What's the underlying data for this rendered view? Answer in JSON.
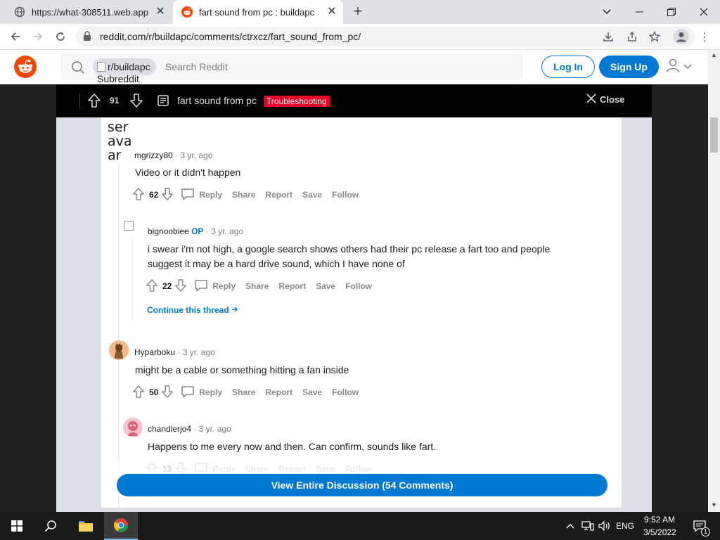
{
  "browser": {
    "tabs": [
      {
        "title": "https://what-308511.web.app",
        "icon": "globe-icon"
      },
      {
        "title": "fart sound from pc : buildapc",
        "icon": "reddit-favicon"
      }
    ],
    "url": "reddit.com/r/buildapc/comments/ctrxcz/fart_sound_from_pc/"
  },
  "reddit": {
    "search": {
      "chip": "r/buildapc",
      "chip_sub": "Subreddit",
      "placeholder": "Search Reddit"
    },
    "login": "Log In",
    "signup": "Sign Up"
  },
  "post": {
    "votes": "91",
    "title": "fart sound from pc",
    "flair": "Troubleshooting",
    "close": "Close"
  },
  "comments": [
    {
      "avatar_alt": "ser ava ar",
      "user": "mgrizzy80",
      "age": "3 yr. ago",
      "body": "Video or it didn't happen",
      "votes": "62"
    },
    {
      "user": "bignoobiee",
      "op": "OP",
      "age": "3 yr. ago",
      "body": "i swear i'm not high, a google search shows others had their pc release a fart too and people suggest it may be a hard drive sound, which I have none of",
      "votes": "22",
      "continue": "Continue this thread"
    },
    {
      "user": "Hyparboku",
      "age": "3 yr. ago",
      "body": "might be a cable or something hitting a fan inside",
      "votes": "50"
    },
    {
      "user": "chandlerjo4",
      "age": "3 yr. ago",
      "body": "Happens to me every now and then. Can confirm, sounds like fart.",
      "votes": "13"
    }
  ],
  "actions": {
    "reply": "Reply",
    "share": "Share",
    "report": "Report",
    "save": "Save",
    "follow": "Follow"
  },
  "view_all": "View Entire Discussion (54 Comments)",
  "taskbar": {
    "lang": "ENG",
    "time": "9:52 AM",
    "date": "3/5/2022",
    "notifications": "1"
  },
  "colors": {
    "reddit_orange": "#ff4500",
    "reddit_blue": "#0079d3",
    "flair_red": "#ea0027"
  }
}
